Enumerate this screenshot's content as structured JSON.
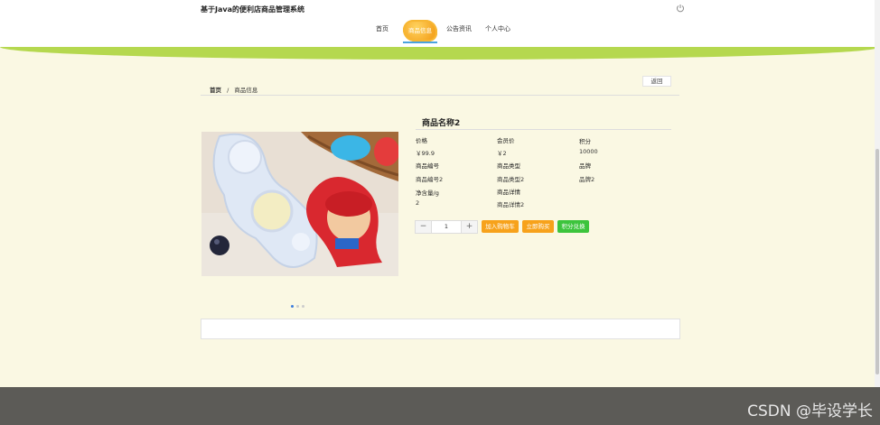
{
  "header": {
    "site_title": "基于Java的便利店商品管理系统",
    "nav": [
      {
        "label": "首页"
      },
      {
        "label": "商品信息"
      },
      {
        "label": "公告资讯"
      },
      {
        "label": "个人中心"
      }
    ]
  },
  "breadcrumb": {
    "home": "首页",
    "separator": "/",
    "current": "商品信息"
  },
  "back_label": "返回",
  "product": {
    "name": "商品名称2",
    "fields": [
      {
        "label": "价格",
        "value": "￥99.9"
      },
      {
        "label": "会员价",
        "value": "￥2"
      },
      {
        "label": "积分",
        "value": "10000"
      },
      {
        "label": "商品编号",
        "value": "商品编号2"
      },
      {
        "label": "商品类型",
        "value": "商品类型2"
      },
      {
        "label": "品牌",
        "value": "品牌2"
      },
      {
        "label": "净含量/g",
        "value": "2"
      },
      {
        "label": "商品详情",
        "value": "商品详情2"
      }
    ],
    "quantity": "1",
    "stepper": {
      "minus": "−",
      "plus": "+"
    },
    "actions": {
      "add_cart": "加入购物车",
      "buy_now": "立即购买",
      "points": "积分兑换"
    },
    "carousel_dots": 3,
    "carousel_active": 0
  },
  "colors": {
    "accent_orange": "#f7a21b",
    "accent_green": "#3cc43c",
    "band_green": "#b5d84f"
  },
  "watermark": "CSDN @毕设学长"
}
